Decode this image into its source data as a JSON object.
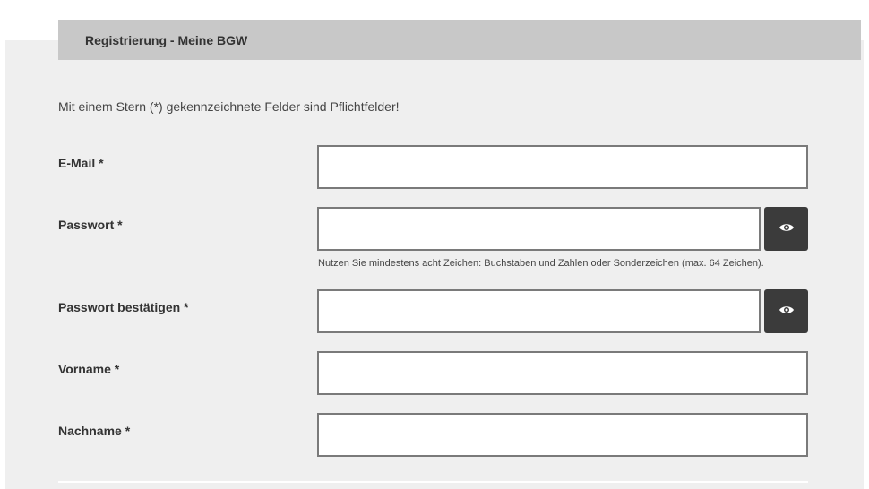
{
  "header": {
    "title": "Registrierung - Meine BGW"
  },
  "form": {
    "intro": "Mit einem Stern (*) gekennzeichnete Felder sind Pflichtfelder!",
    "email": {
      "label": "E-Mail *",
      "value": ""
    },
    "password": {
      "label": "Passwort *",
      "value": "",
      "hint": "Nutzen Sie mindestens acht Zeichen: Buchstaben und Zahlen oder Sonderzeichen (max. 64 Zeichen).",
      "toggle_icon": "eye-icon"
    },
    "password_confirm": {
      "label": "Passwort bestätigen *",
      "value": "",
      "toggle_icon": "eye-icon"
    },
    "firstname": {
      "label": "Vorname *",
      "value": ""
    },
    "lastname": {
      "label": "Nachname *",
      "value": ""
    }
  },
  "colors": {
    "header_bg": "#c8c8c8",
    "panel_bg": "#efefef",
    "button_bg": "#3b3b3b",
    "border": "#7a7a7a"
  }
}
